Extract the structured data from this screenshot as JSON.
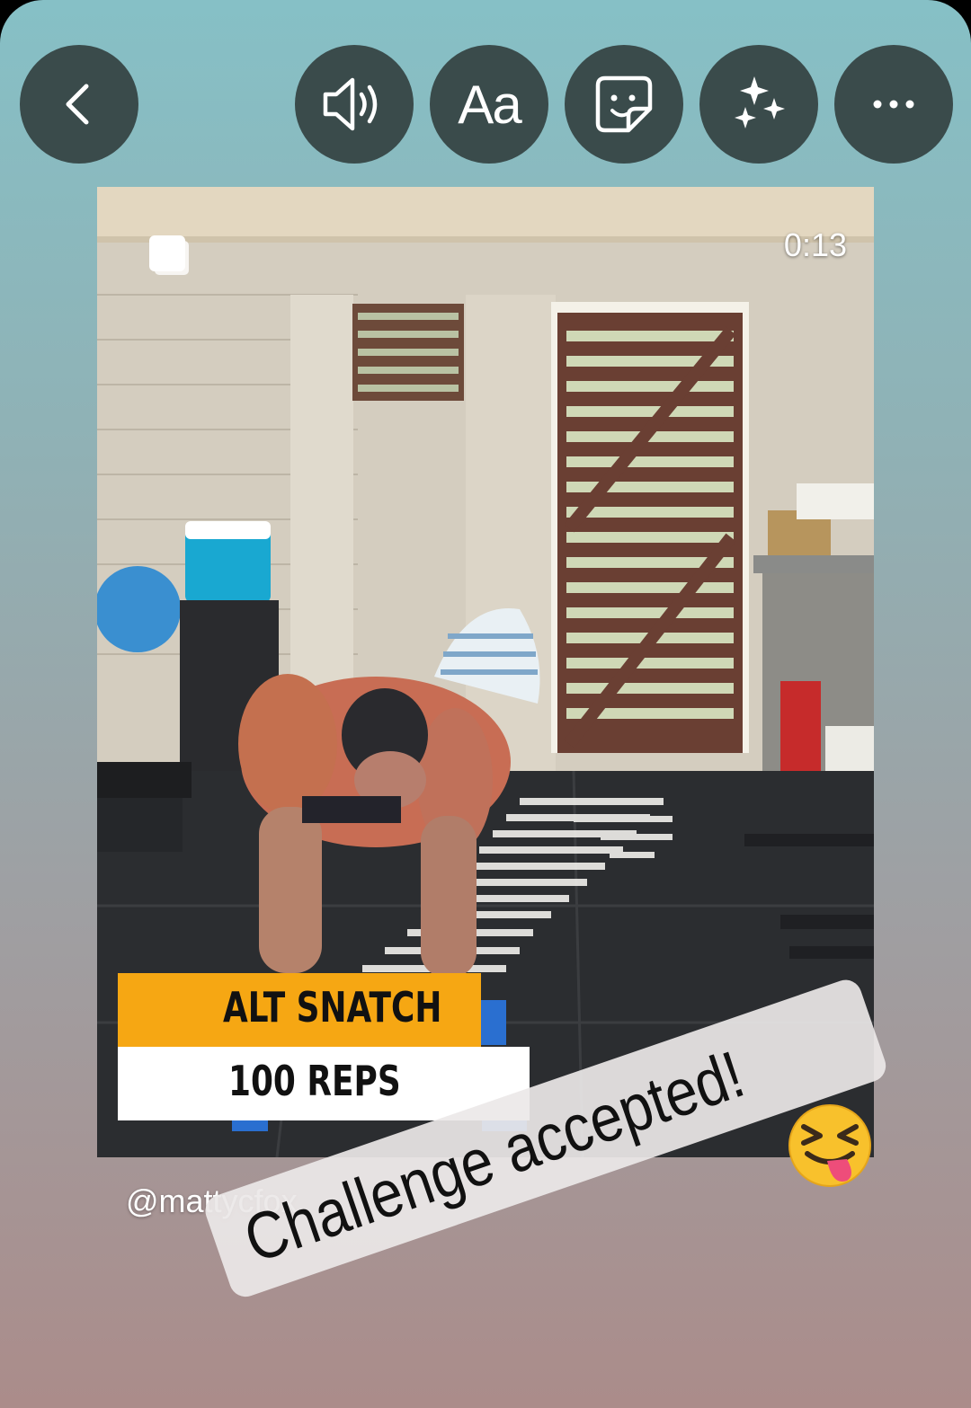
{
  "toolbar": {
    "back": "back",
    "text_tool_label": "Aa",
    "more_label": "..."
  },
  "icons": {
    "back": "chevron-left-icon",
    "sound": "speaker-icon",
    "text": "text-icon",
    "sticker": "sticker-icon",
    "effects": "sparkles-icon",
    "more": "more-icon"
  },
  "video": {
    "timestamp": "0:13",
    "exercise_title": "ALT SNATCH",
    "exercise_reps": "100 REPS"
  },
  "overlay": {
    "mention": "@mattycfox",
    "sticker_text": "Challenge accepted!",
    "emoji": "squinting-face-with-tongue"
  },
  "colors": {
    "button_bg": "#3a4b4b",
    "label_orange": "#f6a713",
    "gradient_top": "#86c0c6",
    "gradient_bottom": "#ab8c8a"
  }
}
